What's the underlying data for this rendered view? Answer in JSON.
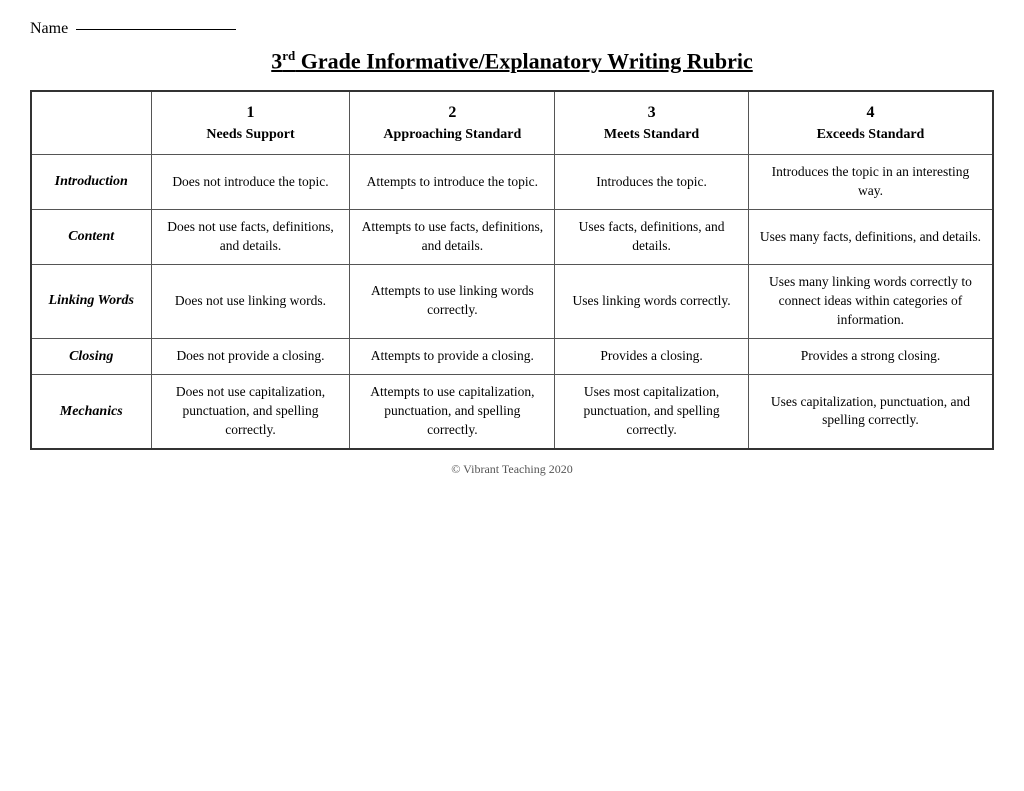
{
  "name_label": "Name",
  "title": "3rd Grade Informative/Explanatory Writing Rubric",
  "title_sup": "rd",
  "header_col1_num": "1",
  "header_col1_label": "Needs Support",
  "header_col2_num": "2",
  "header_col2_label": "Approaching Standard",
  "header_col3_num": "3",
  "header_col3_label": "Meets Standard",
  "header_col4_num": "4",
  "header_col4_label": "Exceeds Standard",
  "rows": [
    {
      "label": "Introduction",
      "col1": "Does not introduce the topic.",
      "col2": "Attempts to introduce the topic.",
      "col3": "Introduces the topic.",
      "col4": "Introduces the topic in an interesting way."
    },
    {
      "label": "Content",
      "col1": "Does not use facts, definitions, and details.",
      "col2": "Attempts to use facts, definitions, and details.",
      "col3": "Uses facts, definitions, and details.",
      "col4": "Uses many facts, definitions, and details."
    },
    {
      "label": "Linking Words",
      "col1": "Does not use linking words.",
      "col2": "Attempts to use linking words correctly.",
      "col3": "Uses linking words correctly.",
      "col4": "Uses many linking words correctly to connect ideas within categories of information."
    },
    {
      "label": "Closing",
      "col1": "Does not provide a closing.",
      "col2": "Attempts to provide a closing.",
      "col3": "Provides a closing.",
      "col4": "Provides a strong closing."
    },
    {
      "label": "Mechanics",
      "col1": "Does not use capitalization, punctuation, and spelling correctly.",
      "col2": "Attempts to use capitalization, punctuation, and spelling correctly.",
      "col3": "Uses most capitalization, punctuation, and spelling correctly.",
      "col4": "Uses capitalization, punctuation, and spelling correctly."
    }
  ],
  "footer": "© Vibrant Teaching 2020"
}
